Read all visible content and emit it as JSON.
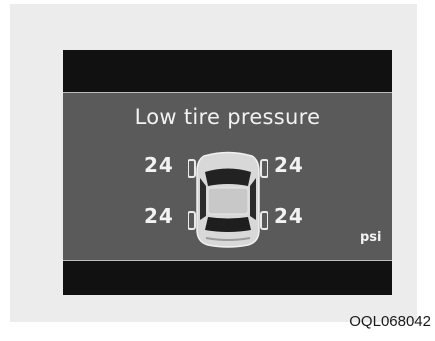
{
  "display": {
    "title": "Low tire pressure",
    "pressures": {
      "front_left": "24",
      "front_right": "24",
      "rear_left": "24",
      "rear_right": "24"
    },
    "unit": "psi"
  },
  "figure_code": "OQL068042",
  "icons": [
    "car-top-view-icon",
    "tire-icon"
  ],
  "colors": {
    "screen_bg": "#5a5a5a",
    "bezel": "#111111",
    "text": "#f2f2f2",
    "card_bg": "#ececec"
  }
}
